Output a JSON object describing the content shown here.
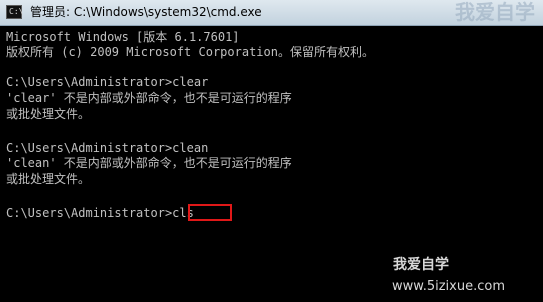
{
  "window": {
    "title": "管理员: C:\\Windows\\system32\\cmd.exe",
    "icon": "cmd-icon",
    "icon_glyph": "C:\\",
    "watermark": "我爱自学"
  },
  "console": {
    "lines": [
      "Microsoft Windows [版本 6.1.7601]",
      "版权所有 (c) 2009 Microsoft Corporation。保留所有权利。",
      "",
      "C:\\Users\\Administrator>clear",
      "'clear' 不是内部或外部命令，也不是可运行的程序",
      "或批处理文件。",
      "",
      "C:\\Users\\Administrator>clean",
      "'clean' 不是内部或外部命令，也不是可运行的程序",
      "或批处理文件。",
      "",
      "C:\\Users\\Administrator>cls"
    ],
    "highlight_color": "#e01818"
  },
  "footer": {
    "site_name": "我爱自学",
    "site_url": "www.5izixue.com"
  }
}
